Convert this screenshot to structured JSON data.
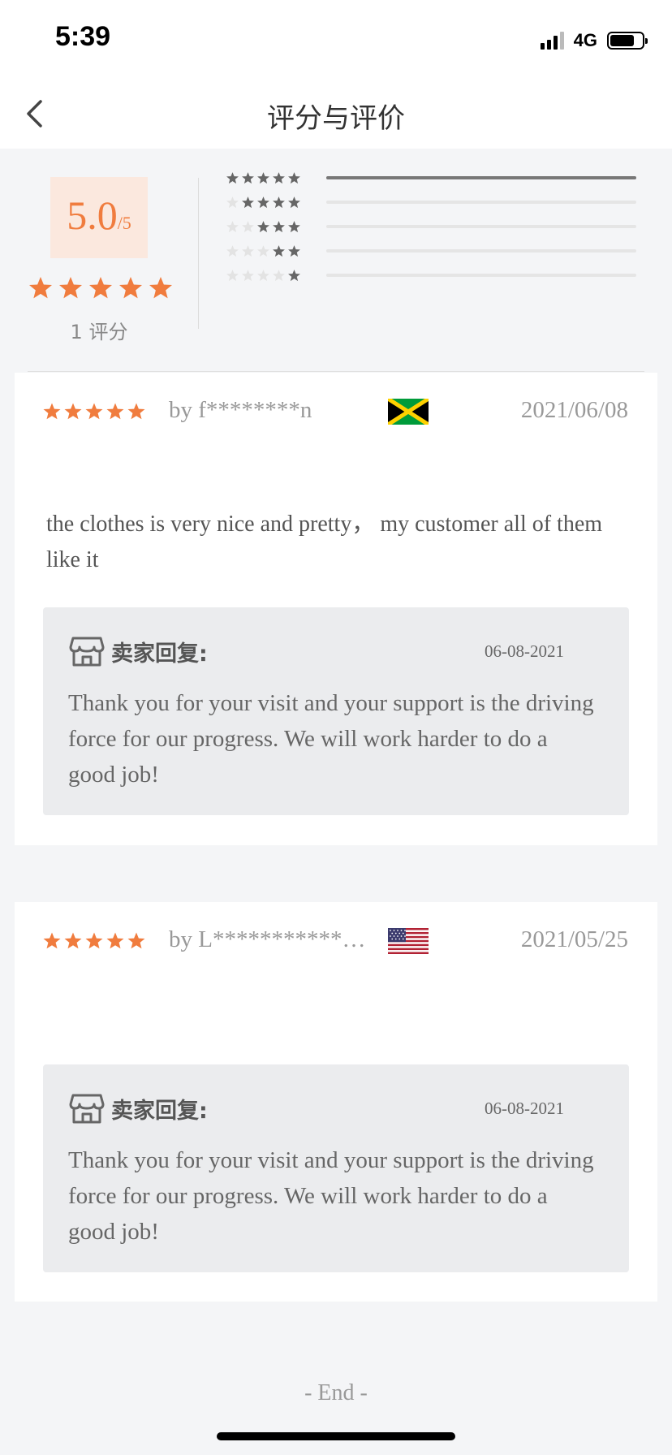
{
  "status": {
    "time": "5:39",
    "network": "4G"
  },
  "header": {
    "title": "评分与评价",
    "back_icon": "chevron-left-icon"
  },
  "summary": {
    "score": "5.0",
    "score_suffix": "/5",
    "stars": 5,
    "rating_count": "1 评分",
    "distribution": [
      {
        "stars": 5,
        "fraction": 1.0
      },
      {
        "stars": 4,
        "fraction": 0.0
      },
      {
        "stars": 3,
        "fraction": 0.0
      },
      {
        "stars": 2,
        "fraction": 0.0
      },
      {
        "stars": 1,
        "fraction": 0.0
      }
    ]
  },
  "reviews": [
    {
      "stars": 5,
      "author": "by f********n",
      "country_flag": "jamaica-flag",
      "date": "2021/06/08",
      "comment": "the clothes is very nice and pretty，  my customer all of them like it",
      "reply": {
        "icon": "store-icon",
        "label": "卖家回复:",
        "date": "06-08-2021",
        "text": "Thank you for your visit and your support is the driving force for our progress. We will work harder to do a good job!"
      }
    },
    {
      "stars": 5,
      "author": "by L***********…",
      "country_flag": "usa-flag",
      "date": "2021/05/25",
      "comment": "",
      "reply": {
        "icon": "store-icon",
        "label": "卖家回复:",
        "date": "06-08-2021",
        "text": "Thank you for your visit and your support is the driving force for our progress. We will work harder to do a good job!"
      }
    }
  ],
  "footer": {
    "end_text": "- End -"
  },
  "colors": {
    "accent": "#f07c3e",
    "score_bg": "#fbe8de",
    "star_gray": "#666666",
    "star_empty": "#e3e3e3"
  }
}
